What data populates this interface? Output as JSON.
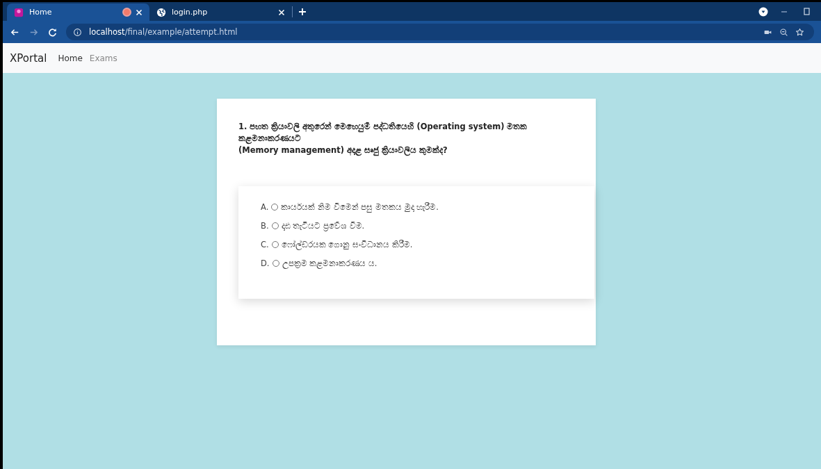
{
  "browser": {
    "tabs": [
      {
        "title": "Home",
        "selected": true,
        "recording": true
      },
      {
        "title": "login.php",
        "selected": false,
        "recording": false
      }
    ],
    "url_host": "localhost",
    "url_path": "/final/example/attempt.html"
  },
  "navbar": {
    "brand": "XPortal",
    "links": [
      {
        "label": "Home",
        "active": true
      },
      {
        "label": "Exams",
        "active": false
      }
    ]
  },
  "question": {
    "lines": [
      "1. පහත ක්‍රියාවලි අතුරෙන් මෙහෙයුම් පද්ධතියෙහි (Operating system) මතක කළමනාකරණයට",
      "(Memory management) අදාළ සෘජු ක්‍රියාවලිය කුමක්ද?"
    ],
    "options": [
      {
        "letter": "A.",
        "text": "කාර්යයක් නිම වීමෙන් පසු මතකය මුදා හැරීම.",
        "selected": false
      },
      {
        "letter": "B.",
        "text": "දෘඪ තැටියට ප්‍රවේශ වීම.",
        "selected": false
      },
      {
        "letter": "C.",
        "text": "ෆෝල්ඩරයක ගොනු සංවිධානය කිරීම.",
        "selected": false
      },
      {
        "letter": "D.",
        "text": "උපක්‍රම කළමනාකරණය ය.",
        "selected": false
      }
    ]
  }
}
